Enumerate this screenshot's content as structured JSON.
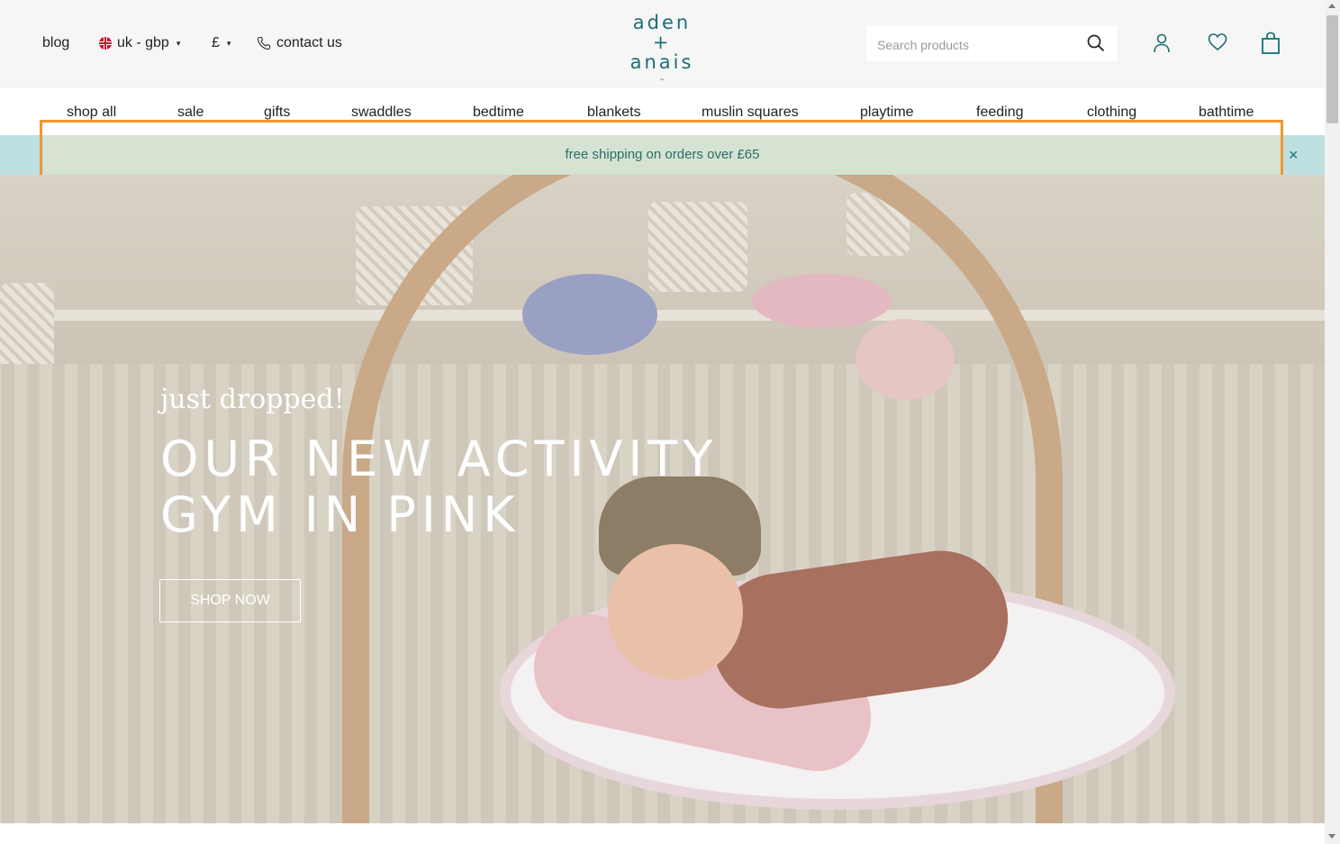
{
  "header": {
    "utility": {
      "blog": "blog",
      "region": "uk - gbp",
      "currency": "£",
      "contact": "contact us"
    },
    "logo": {
      "line1": "aden",
      "line2": "+",
      "line3": "anais",
      "tm": "™"
    },
    "search": {
      "placeholder": "Search products",
      "value": ""
    },
    "icons": [
      "search-icon",
      "account-icon",
      "wishlist-heart-icon",
      "cart-bag-icon"
    ]
  },
  "nav": {
    "items": [
      {
        "label": "shop all"
      },
      {
        "label": "sale"
      },
      {
        "label": "gifts"
      },
      {
        "label": "swaddles"
      },
      {
        "label": "bedtime"
      },
      {
        "label": "blankets"
      },
      {
        "label": "muslin squares"
      },
      {
        "label": "playtime"
      },
      {
        "label": "feeding"
      },
      {
        "label": "clothing"
      },
      {
        "label": "bathtime"
      }
    ]
  },
  "promo": {
    "text": "free shipping on orders over £65",
    "close": "×"
  },
  "hero": {
    "kicker": "just dropped!",
    "title_line1": "OUR NEW ACTIVITY",
    "title_line2": "GYM IN PINK",
    "cta": "SHOP NOW"
  },
  "colors": {
    "brand_teal": "#1a6f76",
    "promo_bg": "#d6e3d2",
    "highlight": "#f0982e"
  }
}
